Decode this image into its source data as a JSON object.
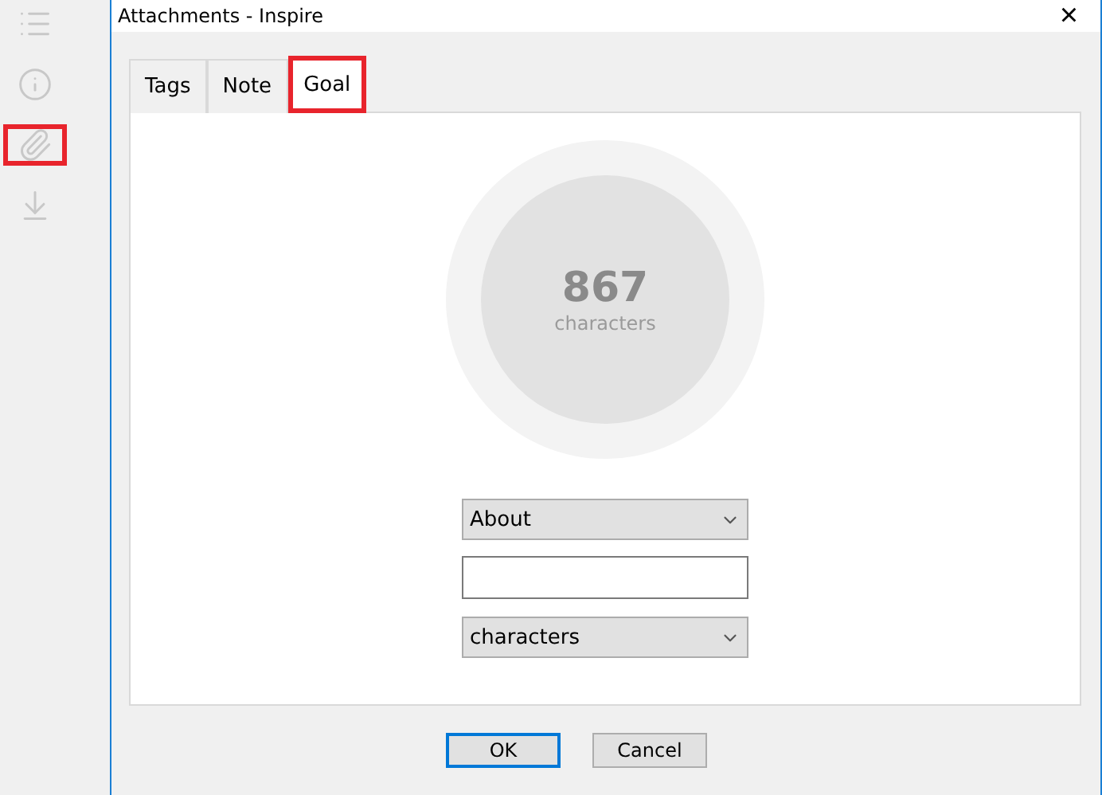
{
  "sidebar": {
    "items": [
      {
        "kind": "list",
        "highlighted": false
      },
      {
        "kind": "info",
        "highlighted": false
      },
      {
        "kind": "attachment",
        "highlighted": true
      },
      {
        "kind": "download",
        "highlighted": false
      }
    ]
  },
  "window": {
    "title": "Attachments - Inspire",
    "close": "×"
  },
  "tabs": [
    {
      "label": "Tags",
      "selected": false,
      "highlighted": false
    },
    {
      "label": "Note",
      "selected": false,
      "highlighted": false
    },
    {
      "label": "Goal",
      "selected": true,
      "highlighted": true
    }
  ],
  "goal": {
    "count": "867",
    "unit": "characters",
    "mode": {
      "value": "About"
    },
    "unit_select": {
      "value": "characters"
    }
  },
  "buttons": [
    {
      "label": "OK",
      "default": true
    },
    {
      "label": "Cancel",
      "default": false
    }
  ]
}
